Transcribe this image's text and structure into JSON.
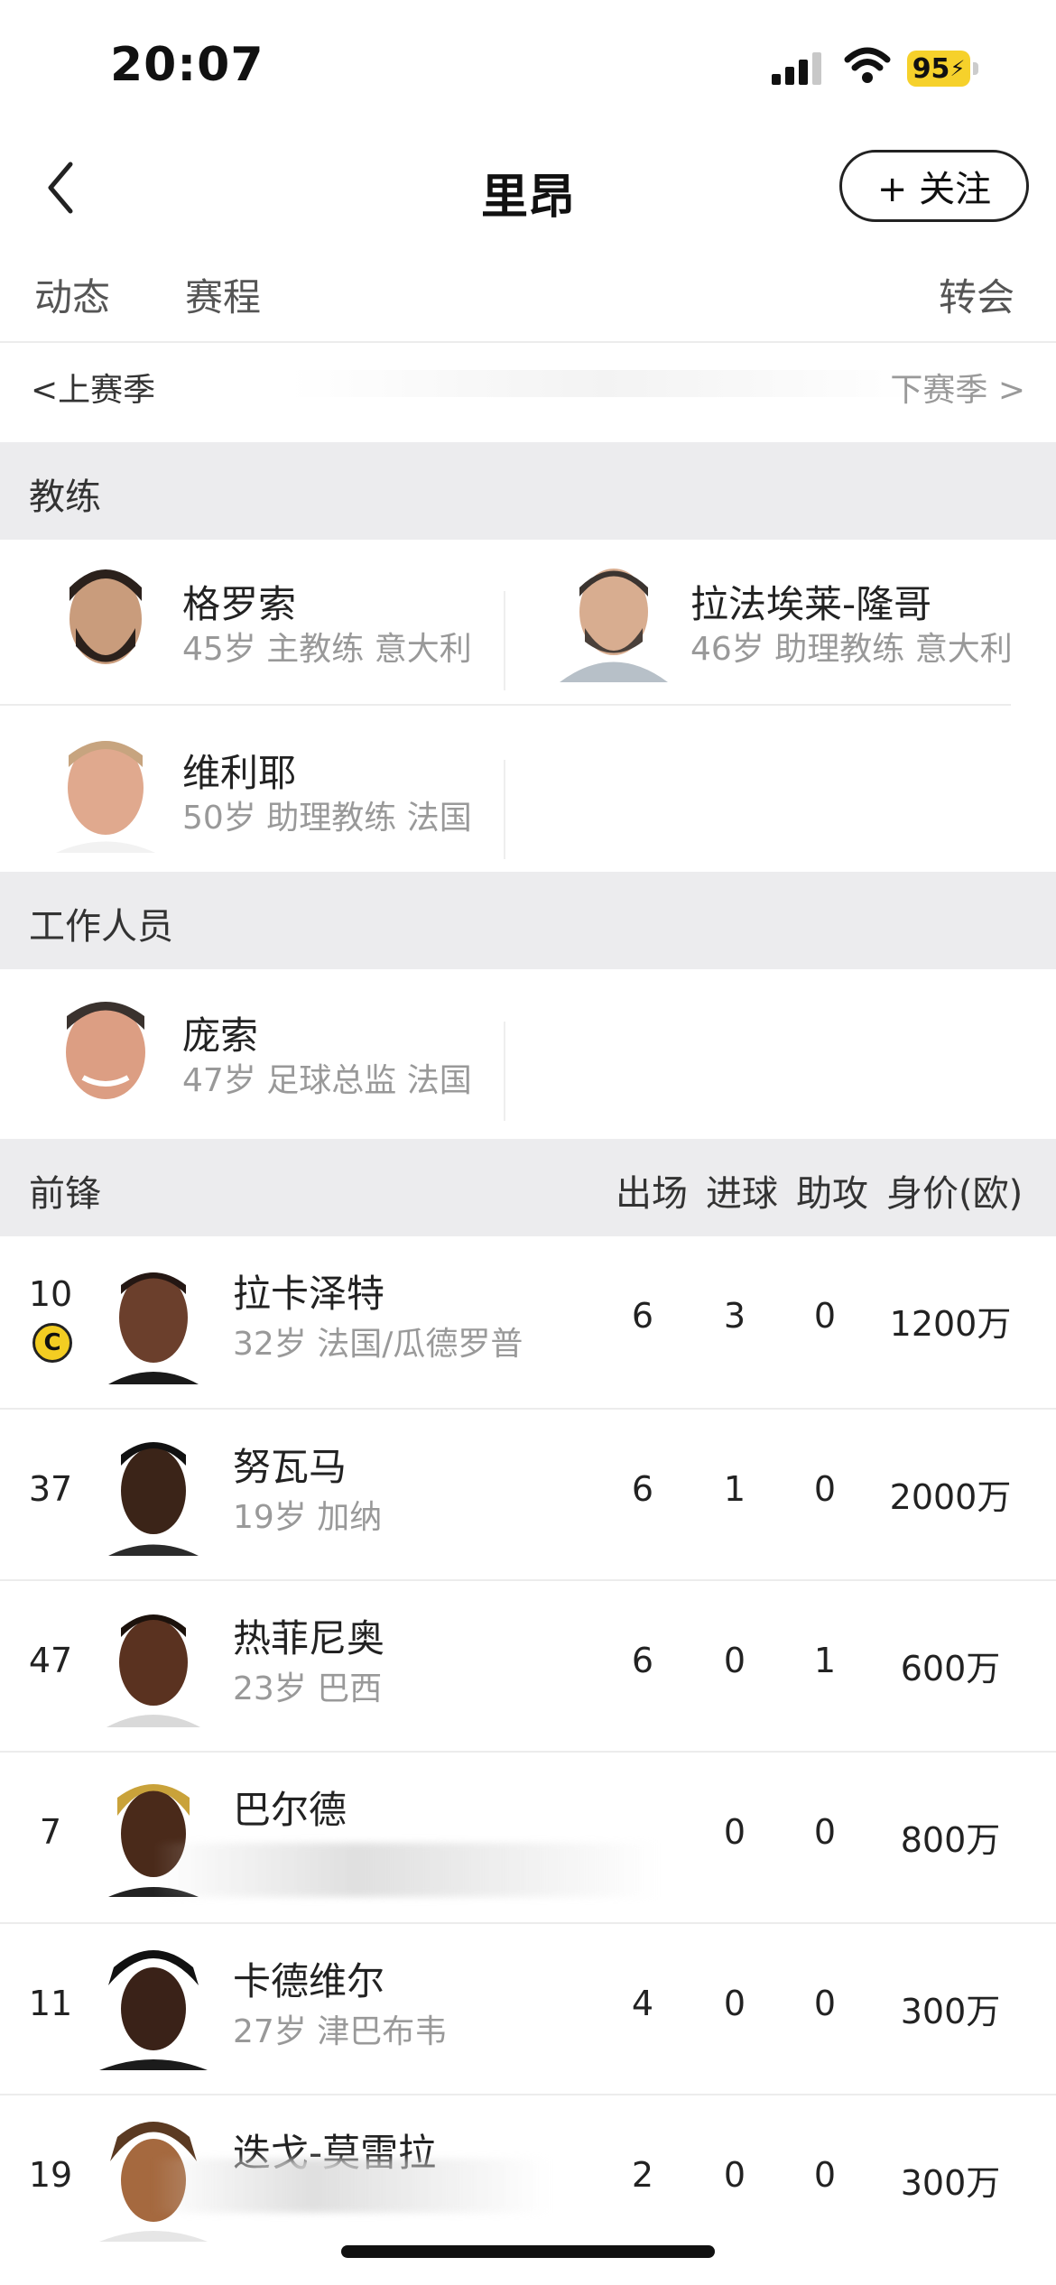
{
  "status": {
    "time": "20:07",
    "battery": "95"
  },
  "header": {
    "title": "里昂",
    "follow_label": "+ 关注"
  },
  "tabs": [
    "动态",
    "赛程",
    "转会"
  ],
  "season": {
    "prev": "上赛季",
    "next": "下赛季"
  },
  "sections": {
    "coaches": "教练",
    "staff": "工作人员",
    "forwards": "前锋"
  },
  "coaches": [
    {
      "name": "格罗索",
      "info": "45岁 主教练 意大利"
    },
    {
      "name": "拉法埃莱-隆哥",
      "info": "46岁 助理教练 意大利"
    },
    {
      "name": "维利耶",
      "info": "50岁 助理教练 法国"
    }
  ],
  "staff": [
    {
      "name": "庞索",
      "info": "47岁 足球总监 法国"
    }
  ],
  "stat_headers": [
    "出场",
    "进球",
    "助攻",
    "身价(欧)"
  ],
  "captain_badge": "C",
  "players": [
    {
      "number": "10",
      "name": "拉卡泽特",
      "info": "32岁 法国/瓜德罗普",
      "apps": "6",
      "goals": "3",
      "assists": "0",
      "value": "1200万"
    },
    {
      "number": "37",
      "name": "努瓦马",
      "info": "19岁 加纳",
      "apps": "6",
      "goals": "1",
      "assists": "0",
      "value": "2000万"
    },
    {
      "number": "47",
      "name": "热菲尼奥",
      "info": "23岁 巴西",
      "apps": "6",
      "goals": "0",
      "assists": "1",
      "value": "600万"
    },
    {
      "number": "7",
      "name": "巴尔德",
      "info": "",
      "apps": "",
      "goals": "0",
      "assists": "0",
      "value": "800万"
    },
    {
      "number": "11",
      "name": "卡德维尔",
      "info": "27岁 津巴布韦",
      "apps": "4",
      "goals": "0",
      "assists": "0",
      "value": "300万"
    },
    {
      "number": "19",
      "name": "迭戈-莫雷拉",
      "info": "",
      "apps": "2",
      "goals": "0",
      "assists": "0",
      "value": "300万"
    }
  ]
}
